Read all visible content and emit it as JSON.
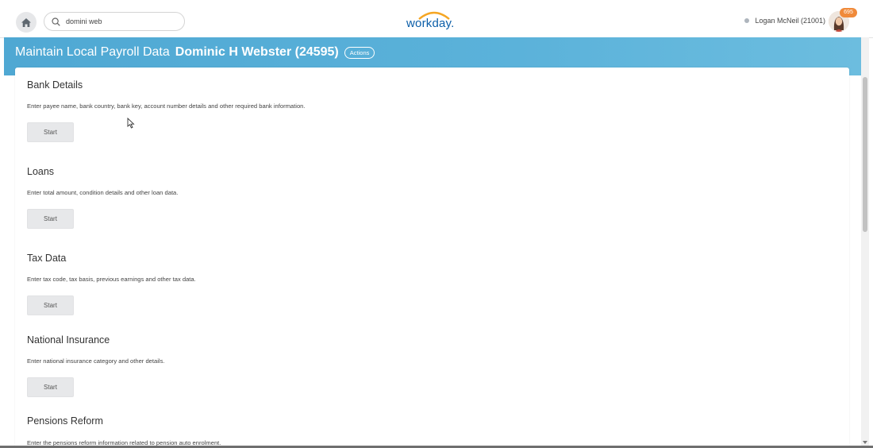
{
  "topbar": {
    "search_value": "domini web",
    "logo": "workday.",
    "user_name": "Logan McNeil (21001)",
    "notification_count": "695"
  },
  "header": {
    "title": "Maintain Local Payroll Data",
    "worker": "Dominic H Webster (24595)",
    "actions_label": "Actions",
    "band_color": "#5bb2da"
  },
  "sections": [
    {
      "title": "Bank Details",
      "description": "Enter payee name, bank country, bank key, account number details and other required bank information.",
      "button": "Start"
    },
    {
      "title": "Loans",
      "description": "Enter total amount, condition details and other loan data.",
      "button": "Start"
    },
    {
      "title": "Tax Data",
      "description": "Enter tax code, tax basis, previous earnings and other tax data.",
      "button": "Start"
    },
    {
      "title": "National Insurance",
      "description": "Enter national insurance category and other details.",
      "button": "Start"
    },
    {
      "title": "Pensions Reform",
      "description": "Enter the pensions reform information related to pension auto enrolment."
    }
  ],
  "icons": {
    "home": "home-icon",
    "search": "search-icon",
    "avatar": "avatar",
    "cursor": "mouse-cursor-icon"
  },
  "colors": {
    "accent": "#4fa8d3",
    "badge": "#f08a3a",
    "logo": "#0b5ea8",
    "logo_arc": "#f5a623"
  }
}
